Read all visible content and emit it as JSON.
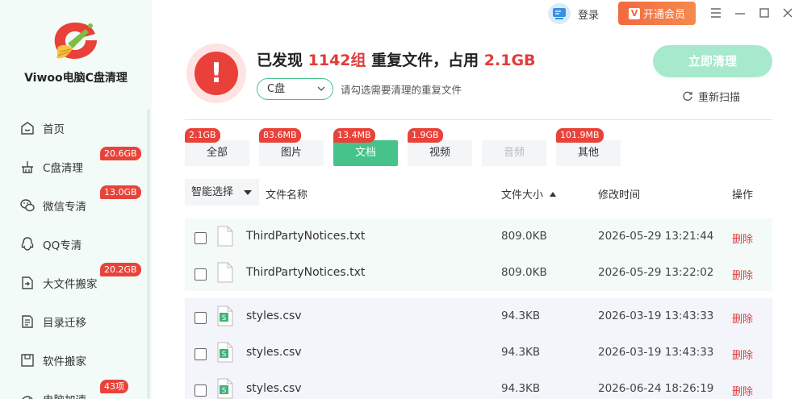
{
  "app": {
    "name": "Viwoo电脑C盘清理"
  },
  "sidebar": {
    "items": [
      {
        "label": "首页",
        "icon": "home-icon",
        "badge": ""
      },
      {
        "label": "C盘清理",
        "icon": "broom-icon",
        "badge": "20.6GB"
      },
      {
        "label": "微信专清",
        "icon": "wechat-icon",
        "badge": "13.0GB"
      },
      {
        "label": "QQ专清",
        "icon": "qq-icon",
        "badge": ""
      },
      {
        "label": "大文件搬家",
        "icon": "move-file-icon",
        "badge": "20.2GB"
      },
      {
        "label": "目录迁移",
        "icon": "folder-migrate-icon",
        "badge": ""
      },
      {
        "label": "软件搬家",
        "icon": "software-move-icon",
        "badge": ""
      },
      {
        "label": "电脑加速",
        "icon": "speedup-icon",
        "badge": "43项"
      }
    ]
  },
  "topbar": {
    "login_label": "登录",
    "vip_label": "开通会员",
    "vip_mark": "V"
  },
  "summary": {
    "prefix": "已发现",
    "groups": "1142组",
    "middle": "重复文件，占用",
    "size": "2.1GB",
    "alert_mark": "!"
  },
  "drive": {
    "selected": "C盘",
    "hint": "请勾选需要清理的重复文件"
  },
  "actions": {
    "clean_label": "立即清理",
    "rescan_label": "重新扫描"
  },
  "tabs": [
    {
      "label": "全部",
      "badge": "2.1GB"
    },
    {
      "label": "图片",
      "badge": "83.6MB"
    },
    {
      "label": "文档",
      "badge": "13.4MB",
      "active": true
    },
    {
      "label": "视频",
      "badge": "1.9GB"
    },
    {
      "label": "音频",
      "badge": ""
    },
    {
      "label": "其他",
      "badge": "101.9MB"
    }
  ],
  "table": {
    "smart_select": "智能选择",
    "col_name": "文件名称",
    "col_size": "文件大小",
    "col_time": "修改时间",
    "col_op": "操作",
    "delete_label": "删除",
    "groups": [
      {
        "rows": [
          {
            "name": "ThirdPartyNotices.txt",
            "size": "809.0KB",
            "time": "2026-05-29 13:21:44",
            "icon": "txt-file-icon"
          },
          {
            "name": "ThirdPartyNotices.txt",
            "size": "809.0KB",
            "time": "2026-05-29 13:22:02",
            "icon": "txt-file-icon"
          }
        ]
      },
      {
        "rows": [
          {
            "name": "styles.csv",
            "size": "94.3KB",
            "time": "2026-03-19 13:43:33",
            "icon": "csv-file-icon"
          },
          {
            "name": "styles.csv",
            "size": "94.3KB",
            "time": "2026-03-19 13:43:33",
            "icon": "csv-file-icon"
          },
          {
            "name": "styles.csv",
            "size": "94.3KB",
            "time": "2026-06-24 18:26:19",
            "icon": "csv-file-icon"
          }
        ]
      }
    ]
  },
  "colors": {
    "accent": "#45c38b",
    "danger": "#e23b3b",
    "vip": "#f26a3f"
  }
}
